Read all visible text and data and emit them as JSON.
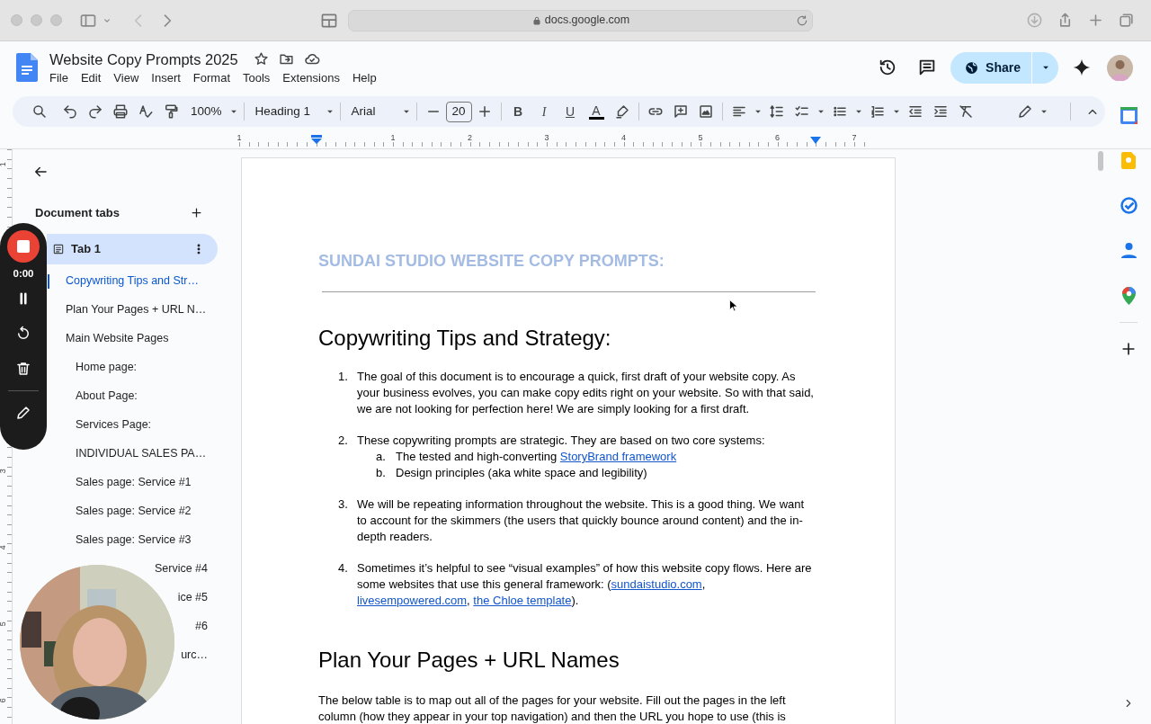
{
  "browser": {
    "url": "docs.google.com"
  },
  "doc_title": "Website Copy Prompts 2025",
  "menu": [
    "File",
    "Edit",
    "View",
    "Insert",
    "Format",
    "Tools",
    "Extensions",
    "Help"
  ],
  "share": {
    "label": "Share"
  },
  "toolbar": {
    "zoom": "100%",
    "style": "Heading 1",
    "font": "Arial",
    "size": "20",
    "format_buttons": [
      "B",
      "I",
      "U",
      "A"
    ]
  },
  "ruler": {
    "horizontal": [
      "1",
      "1",
      "2",
      "3",
      "4",
      "5",
      "6",
      "7"
    ],
    "vertical": [
      "1",
      "3",
      "4",
      "5",
      "6"
    ]
  },
  "recorder": {
    "time": "0:00"
  },
  "sidebar": {
    "title": "Document tabs",
    "tab": {
      "label": "Tab 1",
      "selected": true
    },
    "outline": [
      {
        "text": "Copywriting Tips and Str…",
        "selected": true
      },
      {
        "text": "Plan Your Pages + URL N…",
        "selected": false
      },
      {
        "text": "Main Website Pages",
        "selected": false,
        "children": [
          {
            "text": "Home page:",
            "selected": false,
            "kind": "full"
          },
          {
            "text": "About Page:",
            "selected": false,
            "kind": "full"
          },
          {
            "text": "Services Page:",
            "selected": false,
            "kind": "full"
          },
          {
            "text": "INDIVIDUAL SALES PA…",
            "selected": false,
            "kind": "full"
          },
          {
            "text": "Sales page: Service #1",
            "selected": false,
            "kind": "full"
          },
          {
            "text": "Sales page: Service #2",
            "selected": false,
            "kind": "full"
          },
          {
            "text": "Sales page: Service #3",
            "selected": false,
            "kind": "full"
          },
          {
            "text": "Service #4",
            "selected": false,
            "kind": "partial"
          },
          {
            "text": "ice #5",
            "selected": false,
            "kind": "partial"
          },
          {
            "text": "#6",
            "selected": false,
            "kind": "partial"
          },
          {
            "text": "urc…",
            "selected": false,
            "kind": "partial"
          }
        ]
      }
    ]
  },
  "document": {
    "title": "SUNDAI STUDIO WEBSITE COPY PROMPTS:",
    "sections": [
      {
        "heading": "Copywriting Tips and Strategy:",
        "list": [
          {
            "marker": "1.",
            "segments": [
              {
                "text": "The goal of this document is to encourage a quick, first draft of your website copy. As your business evolves, you can make copy edits right on your website. So with that said, we are not looking for perfection here! We are simply looking for a first draft."
              }
            ]
          },
          {
            "marker": "2.",
            "segments": [
              {
                "text": "These copywriting prompts are strategic. They are based on two core systems:"
              }
            ],
            "sublist": [
              {
                "marker": "a.",
                "segments": [
                  {
                    "text": "The tested and high-converting "
                  },
                  {
                    "text": "StoryBrand framework",
                    "link": true
                  }
                ]
              },
              {
                "marker": "b.",
                "segments": [
                  {
                    "text": "Design principles (aka white space and legibility)"
                  }
                ]
              }
            ]
          },
          {
            "marker": "3.",
            "segments": [
              {
                "text": "We will be repeating information throughout the website. This is a good thing. We want to account for the skimmers (the users that quickly bounce around content) and the in-depth readers."
              }
            ]
          },
          {
            "marker": "4.",
            "segments": [
              {
                "text": "Sometimes it’s helpful to see “visual examples” of how this website copy flows. Here are some websites that use this general framework: ("
              },
              {
                "text": "sundaistudio.com",
                "link": true
              },
              {
                "text": ", "
              },
              {
                "text": "livesempowered.com",
                "link": true
              },
              {
                "text": ", "
              },
              {
                "text": "the Chloe template",
                "link": true
              },
              {
                "text": ")."
              }
            ]
          }
        ]
      },
      {
        "heading": "Plan Your Pages + URL Names",
        "paragraph": "The below table is to map out all of the pages for your website. Fill out the pages in the left column (how they appear in your top navigation) and then the URL you hope to use (this is"
      }
    ]
  }
}
